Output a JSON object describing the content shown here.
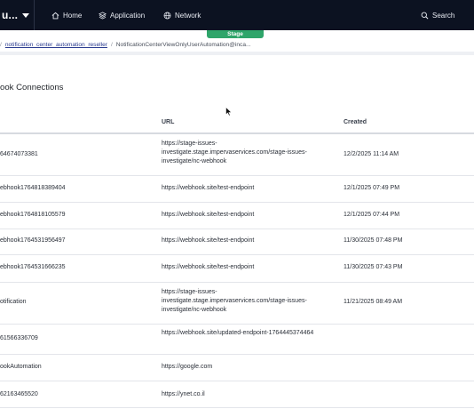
{
  "nav": {
    "brand_text": "u...",
    "items": [
      {
        "label": "Home",
        "icon": "home-icon"
      },
      {
        "label": "Application",
        "icon": "layers-icon"
      },
      {
        "label": "Network",
        "icon": "globe-icon"
      }
    ],
    "search_label": "Search",
    "stage_badge": "Stage"
  },
  "breadcrumb": {
    "items": [
      "notification_center_automation_reseller"
    ],
    "current": "NotificationCenterViewOnlyUserAutomation@inca..."
  },
  "page": {
    "title": "ook Connections"
  },
  "table": {
    "columns": {
      "url": "URL",
      "created": "Created"
    },
    "rows": [
      {
        "name": "64674073381",
        "url": "https://stage-issues-investigate.stage.impervaservices.com/stage-issues-investigate/nc-webhook",
        "created": "12/2/2025 11:14 AM"
      },
      {
        "name": "ebhook1764818389404",
        "url": "https://webhook.site/test-endpoint",
        "created": "12/1/2025 07:49 PM"
      },
      {
        "name": "ebhook1764818105579",
        "url": "https://webhook.site/test-endpoint",
        "created": "12/1/2025 07:44 PM"
      },
      {
        "name": "ebhook1764531956497",
        "url": "https://webhook.site/test-endpoint",
        "created": "11/30/2025 07:48 PM"
      },
      {
        "name": "ebhook1764531666235",
        "url": "https://webhook.site/test-endpoint",
        "created": "11/30/2025 07:43 PM"
      },
      {
        "name": "otification",
        "url": "https://stage-issues-investigate.stage.impervaservices.com/stage-issues-investigate/nc-webhook",
        "created": "11/21/2025 08:49 AM"
      },
      {
        "name": "61566336709",
        "url": "https://webhook.site/updated-endpoint-1764445374464",
        "created": ""
      },
      {
        "name": "ookAutomation",
        "url": "https://google.com",
        "created": ""
      },
      {
        "name": "62163465520",
        "url": "https://ynet.co.il",
        "created": ""
      }
    ]
  },
  "colors": {
    "nav_bg": "#0c1221",
    "stage": "#2fa56a",
    "link": "#2a3b8f"
  }
}
